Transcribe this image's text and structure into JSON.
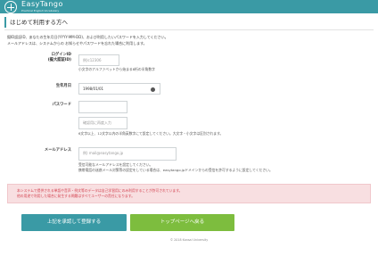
{
  "header": {
    "logo_text": "EasyTango",
    "logo_subtitle": "Practical English Vocabulary"
  },
  "page": {
    "title": "はじめて利用する方へ"
  },
  "intro": {
    "line1": "擬ID認証ID、あなたの生年月日(YYYY-MM-DD)、および利用したいパスワードを入力してください。",
    "line2": "メールアドレスは、システムからの お知らせやパスワードを忘れた場合に利用します。"
  },
  "form": {
    "login_label_1": "ログインID",
    "login_label_2": "(擬大認証ID)",
    "login_placeholder": "例)c12306",
    "login_hint": "小文字のアルファベットから始まる8桁の半角数字",
    "birth_label": "生年月日",
    "birth_value": "1998/01/01",
    "password_label": "パスワード",
    "password_confirm_placeholder": "確認用に再度入力",
    "password_hint": "6文字以上、12文字以内の半角英数字にて設定してください。大文字・小文字は区別されます。",
    "email_label": "メールアドレス",
    "email_placeholder": "例) mail@easytango.jp",
    "email_hint_1": "受信可能なメールアドレスを設定してください。",
    "email_hint_2": "携帯電話の迷惑メール対策等の設定をしている場合は、easytango.jpドメインからの受信を許可するように設定してください。"
  },
  "alert": {
    "line1": "本システムで提供される単語や音声・例文等のデータは自己学習用にのみ利用することが許可されています。",
    "line2": "他の用途で利用した場合に発生する問題はすべてユーザーの責任になります。"
  },
  "buttons": {
    "register": "上記を承認して登録する",
    "top_page": "トップページへ戻る"
  },
  "footer": {
    "copyright": "© 2018 Kansai University"
  }
}
